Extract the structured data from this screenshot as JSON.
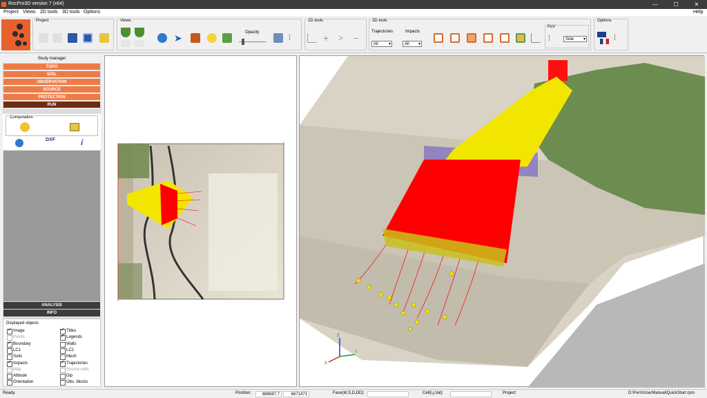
{
  "window": {
    "title": "RocPro3D version 7 (x64)",
    "minimize": "—",
    "maximize": "☐",
    "close": "✕"
  },
  "menu": {
    "items": [
      "Project",
      "Views",
      "2D tools",
      "3D tools",
      "Options"
    ],
    "help": "Help"
  },
  "toolbar": {
    "groups": {
      "project": "Project",
      "views": "Views",
      "tools2d": "2D tools",
      "tools3d": "3D tools",
      "options": "Options"
    },
    "opacity_label": "Opacity",
    "trajectories_label": "Trajectories",
    "trajectories_value": "All",
    "impacts_label": "Impacts",
    "impacts_value": "All",
    "pov_label": "PoV",
    "pov_value": "Side"
  },
  "study_manager": {
    "title": "Study manager",
    "items": [
      "TOPO",
      "SOIL",
      "OBSERVATION",
      "SOURCE",
      "PROTECTION",
      "RUN"
    ],
    "computation_label": "Computation",
    "dxf_label": "DXF",
    "info_glyph": "i",
    "analysis": "ANALYSIS",
    "info": "INFO"
  },
  "displayed_objects": {
    "title": "Displayed objects",
    "items": [
      {
        "label": "Image",
        "checked": true,
        "enabled": true
      },
      {
        "label": "Titles",
        "checked": true,
        "enabled": true
      },
      {
        "label": "Points",
        "checked": false,
        "enabled": false
      },
      {
        "label": "Legends",
        "checked": true,
        "enabled": true
      },
      {
        "label": "Boundary",
        "checked": true,
        "enabled": true
      },
      {
        "label": "Walls",
        "checked": false,
        "enabled": true
      },
      {
        "label": "LC1",
        "checked": false,
        "enabled": true
      },
      {
        "label": "LC2",
        "checked": false,
        "enabled": true
      },
      {
        "label": "Soils",
        "checked": false,
        "enabled": true
      },
      {
        "label": "Mesh",
        "checked": false,
        "enabled": true
      },
      {
        "label": "Impacts",
        "checked": true,
        "enabled": true
      },
      {
        "label": "Trajectories",
        "checked": true,
        "enabled": true
      },
      {
        "label": "Map",
        "checked": false,
        "enabled": false
      },
      {
        "label": "Source cells",
        "checked": false,
        "enabled": false
      },
      {
        "label": "Altitude",
        "checked": false,
        "enabled": true
      },
      {
        "label": "Dip",
        "checked": false,
        "enabled": true
      },
      {
        "label": "Orientation",
        "checked": false,
        "enabled": true
      },
      {
        "label": "Obs. blocks",
        "checked": false,
        "enabled": true
      }
    ]
  },
  "status": {
    "ready": "Ready.",
    "position_label": "Position:",
    "position_x": "888687.7",
    "position_y": "6671471",
    "face_label": "Face(Id,S,D,DD):",
    "cell_label": "Cell(i,j,Val):",
    "project_label": "Project:",
    "project_path": "D:\\Fern\\UserManual\\QuickStart.rpro"
  },
  "axes3d": {
    "x": "X",
    "y": "Y",
    "z": "Z"
  },
  "colors": {
    "accent": "#ef7c47",
    "dark_accent": "#6d2c12",
    "trajectory": "#ff0000",
    "impact": "#f2e600"
  }
}
